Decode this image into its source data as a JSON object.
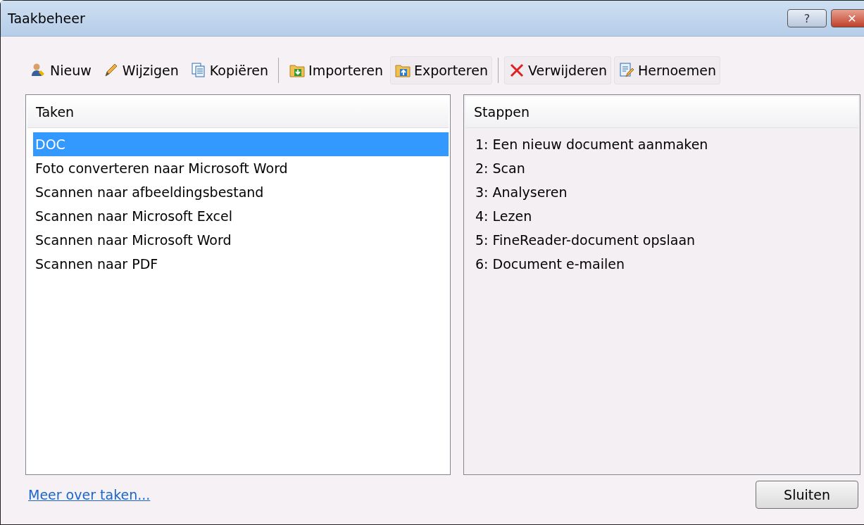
{
  "window": {
    "title": "Taakbeheer",
    "buttons": [
      {
        "kind": "help",
        "label": "?"
      },
      {
        "kind": "close",
        "label": "✕"
      }
    ]
  },
  "toolbar": [
    {
      "kind": "button",
      "label": "Nieuw",
      "framed": false
    },
    {
      "kind": "button",
      "label": "Wijzigen",
      "framed": false
    },
    {
      "kind": "button",
      "label": "Kopiëren",
      "framed": false
    },
    {
      "kind": "separator"
    },
    {
      "kind": "button",
      "label": "Importeren",
      "framed": false
    },
    {
      "kind": "button",
      "label": "Exporteren",
      "framed": true
    },
    {
      "kind": "separator"
    },
    {
      "kind": "button",
      "label": "Verwijderen",
      "framed": true
    },
    {
      "kind": "button",
      "label": "Hernoemen",
      "framed": true
    }
  ],
  "tasks": {
    "header": "Taken",
    "items": [
      {
        "label": "DOC",
        "selected": true
      },
      {
        "label": "Foto converteren naar Microsoft Word",
        "selected": false
      },
      {
        "label": "Scannen naar afbeeldingsbestand",
        "selected": false
      },
      {
        "label": "Scannen naar Microsoft Excel",
        "selected": false
      },
      {
        "label": "Scannen naar Microsoft Word",
        "selected": false
      },
      {
        "label": "Scannen naar PDF",
        "selected": false
      }
    ]
  },
  "steps": {
    "header": "Stappen",
    "items": [
      "1: Een nieuw document aanmaken",
      "2: Scan",
      "3: Analyseren",
      "4: Lezen",
      "5: FineReader-document opslaan",
      "6: Document e-mailen"
    ]
  },
  "footer": {
    "link": "Meer over taken...",
    "button": "Sluiten"
  }
}
